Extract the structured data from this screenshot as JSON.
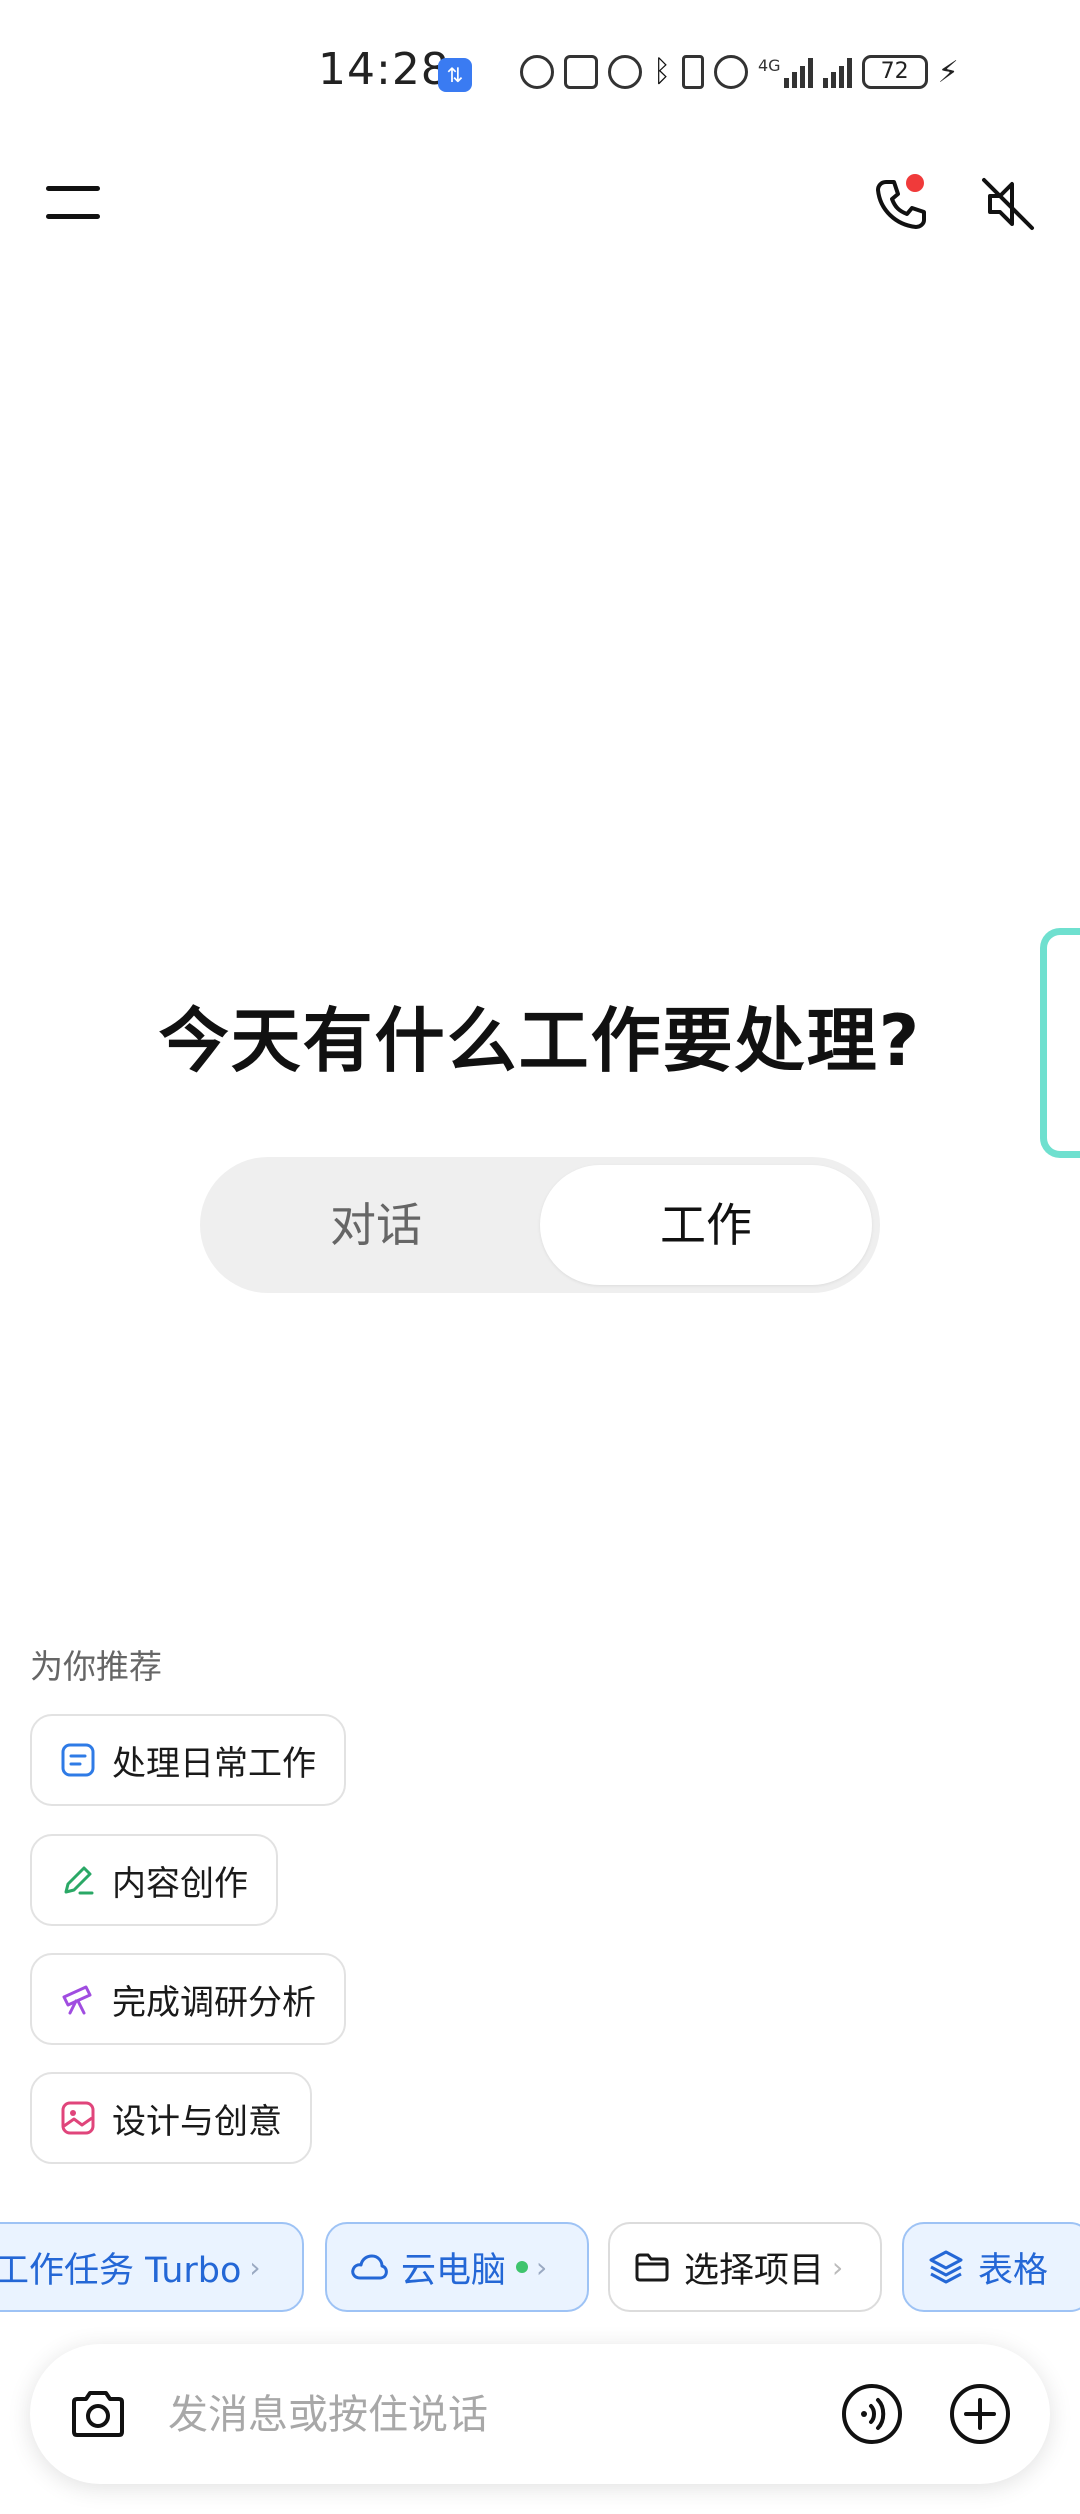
{
  "status_bar": {
    "time": "14:28",
    "network_label": "4G",
    "battery": "72"
  },
  "header": {
    "menu_icon": "menu-icon",
    "call_icon": "phone-icon",
    "mute_icon": "speaker-muted-icon"
  },
  "main": {
    "headline": "今天有什么工作要处理?",
    "mode_tabs": [
      {
        "label": "对话",
        "selected": false
      },
      {
        "label": "工作",
        "selected": true
      }
    ]
  },
  "recommendations": {
    "title": "为你推荐",
    "items": [
      {
        "label": "处理日常工作",
        "icon": "document-icon",
        "color": "#2f7be6"
      },
      {
        "label": "内容创作",
        "icon": "pencil-icon",
        "color": "#2aa866"
      },
      {
        "label": "完成调研分析",
        "icon": "telescope-icon",
        "color": "#a04de0"
      },
      {
        "label": "设计与创意",
        "icon": "image-icon",
        "color": "#e0457b"
      }
    ]
  },
  "chips": [
    {
      "label": "工作任务 Turbo",
      "style": "blue"
    },
    {
      "label": "云电脑",
      "style": "blue",
      "icon": "cloud-icon",
      "status_dot": "#3ec46d"
    },
    {
      "label": "选择项目",
      "style": "plain",
      "icon": "folder-icon"
    },
    {
      "label": "表格",
      "style": "blue",
      "icon": "layers-icon"
    }
  ],
  "chip_chevron": "›",
  "input": {
    "placeholder": "发消息或按住说话",
    "camera_icon": "camera-icon",
    "voice_icon": "voice-icon",
    "add_icon": "plus-icon"
  },
  "colors": {
    "accent_blue": "#2467d6",
    "side_handle": "#6fe0cf",
    "notification": "#f03a3a"
  }
}
